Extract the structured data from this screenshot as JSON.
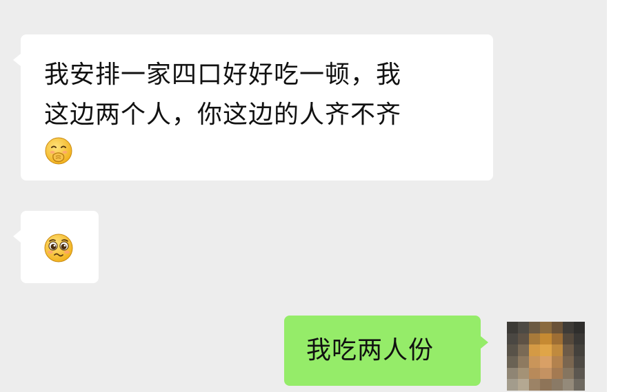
{
  "messages": [
    {
      "id": "msg1",
      "direction": "incoming",
      "text_lines": [
        "我安排一家四口好好吃一顿，我",
        "这边两个人，你这边的人齐不齐"
      ],
      "emoji": "face-with-hand-over-mouth-icon"
    },
    {
      "id": "msg2",
      "direction": "incoming",
      "emoji": "pleading-face-icon"
    },
    {
      "id": "msg3",
      "direction": "outgoing",
      "text": "我吃两人份"
    }
  ],
  "colors": {
    "chat_background": "#ededed",
    "incoming_bubble": "#ffffff",
    "outgoing_bubble": "#95ec69",
    "text": "#111111"
  },
  "avatar": {
    "state": "pixelated"
  }
}
